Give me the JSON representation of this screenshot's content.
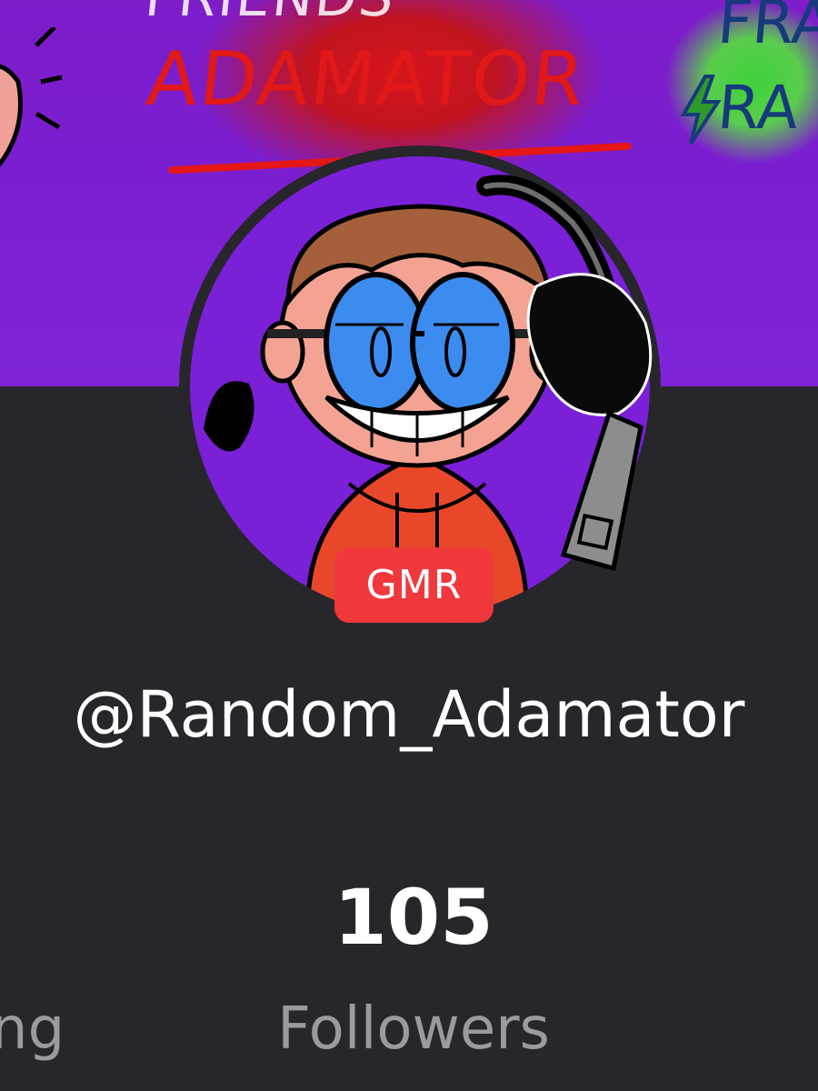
{
  "banner": {
    "top_text": "FRIENDS",
    "main_text": "ADAMATOR",
    "right_text_top": "FRA",
    "right_text_bottom": "RA"
  },
  "profile": {
    "badge": "GMR",
    "username": "@Random_Adamator"
  },
  "stats": {
    "left_label_partial": "ng",
    "followers_count": "105",
    "followers_label": "Followers"
  },
  "colors": {
    "background": "#27262b",
    "banner_purple": "#7a20d6",
    "banner_red": "#d7141d",
    "badge": "#f0383d",
    "label_gray": "#9a9aa0"
  }
}
